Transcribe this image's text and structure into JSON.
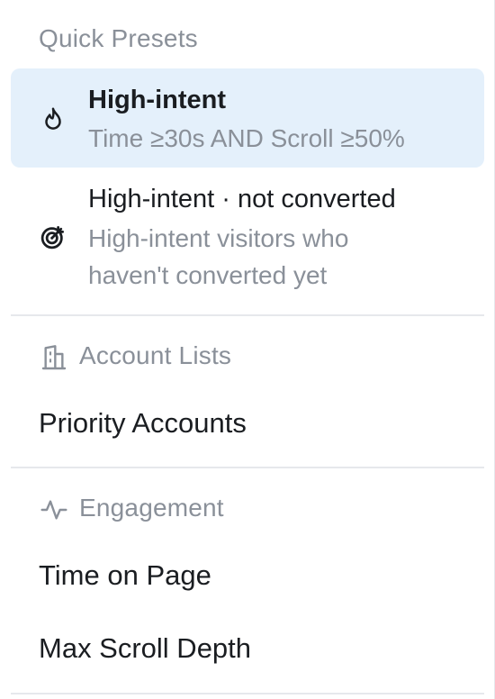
{
  "quick_presets": {
    "label": "Quick Presets",
    "items": [
      {
        "title": "High-intent",
        "description": "Time ≥30s AND Scroll ≥50%",
        "icon": "flame-icon",
        "selected": true
      },
      {
        "title": "High-intent · not converted",
        "description_lines": [
          "High-intent visitors who",
          "haven't converted yet"
        ],
        "icon": "target-icon",
        "selected": false
      }
    ]
  },
  "account_lists": {
    "label": "Account Lists",
    "icon": "building-icon",
    "items": [
      {
        "label": "Priority Accounts"
      }
    ]
  },
  "engagement": {
    "label": "Engagement",
    "icon": "activity-icon",
    "items": [
      {
        "label": "Time on Page"
      },
      {
        "label": "Max Scroll Depth"
      }
    ]
  },
  "colors": {
    "selected_bg": "#e4f0fb",
    "muted_text": "#8a9099",
    "primary_text": "#1a1d21",
    "divider": "#e6e8ec"
  }
}
